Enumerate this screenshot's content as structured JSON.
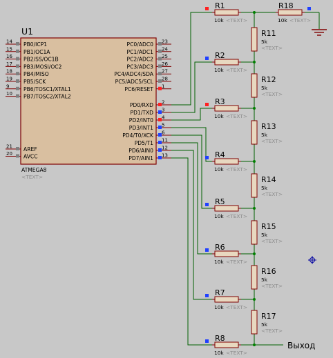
{
  "mcu": {
    "ref": "U1",
    "part": "ATMEGA8",
    "text_placeholder": "<TEXT>",
    "left_pins": [
      {
        "num": "14",
        "name": "PB0/ICP1"
      },
      {
        "num": "15",
        "name": "PB1/OC1A"
      },
      {
        "num": "16",
        "name": "PB2/SS/OC1B"
      },
      {
        "num": "17",
        "name": "PB3/MOSI/OC2"
      },
      {
        "num": "18",
        "name": "PB4/MISO"
      },
      {
        "num": "19",
        "name": "PB5/SCK"
      },
      {
        "num": "9",
        "name": "PB6/TOSC1/XTAL1"
      },
      {
        "num": "10",
        "name": "PB7/TOSC2/XTAL2"
      }
    ],
    "left_pins_bottom": [
      {
        "num": "21",
        "name": "AREF"
      },
      {
        "num": "20",
        "name": "AVCC"
      }
    ],
    "right_pins_top": [
      {
        "num": "23",
        "name": "PC0/ADC0"
      },
      {
        "num": "24",
        "name": "PC1/ADC1"
      },
      {
        "num": "25",
        "name": "PC2/ADC2"
      },
      {
        "num": "26",
        "name": "PC3/ADC3"
      },
      {
        "num": "27",
        "name": "PC4/ADC4/SDA"
      },
      {
        "num": "28",
        "name": "PC5/ADC5/SCL"
      },
      {
        "num": "1",
        "name": "PC6/RESET"
      }
    ],
    "right_pins_bottom": [
      {
        "num": "2",
        "name": "PD0/RXD"
      },
      {
        "num": "3",
        "name": "PD1/TXD"
      },
      {
        "num": "4",
        "name": "PD2/INT0"
      },
      {
        "num": "5",
        "name": "PD3/INT1"
      },
      {
        "num": "6",
        "name": "PD4/T0/XCK"
      },
      {
        "num": "11",
        "name": "PD5/T1"
      },
      {
        "num": "12",
        "name": "PD6/AIN0"
      },
      {
        "num": "13",
        "name": "PD7/AIN1"
      }
    ]
  },
  "resistors_h": [
    {
      "ref": "R1",
      "value": "10k",
      "text": "<TEXT>"
    },
    {
      "ref": "R2",
      "value": "10k",
      "text": "<TEXT>"
    },
    {
      "ref": "R3",
      "value": "10k",
      "text": "<TEXT>"
    },
    {
      "ref": "R4",
      "value": "10k",
      "text": "<TEXT>"
    },
    {
      "ref": "R5",
      "value": "10k",
      "text": "<TEXT>"
    },
    {
      "ref": "R6",
      "value": "10k",
      "text": "<TEXT>"
    },
    {
      "ref": "R7",
      "value": "10k",
      "text": "<TEXT>"
    },
    {
      "ref": "R8",
      "value": "10k",
      "text": "<TEXT>"
    },
    {
      "ref": "R18",
      "value": "10k",
      "text": "<TEXT>"
    }
  ],
  "resistors_v": [
    {
      "ref": "R11",
      "value": "5k",
      "text": "<TEXT>"
    },
    {
      "ref": "R12",
      "value": "5k",
      "text": "<TEXT>"
    },
    {
      "ref": "R13",
      "value": "5k",
      "text": "<TEXT>"
    },
    {
      "ref": "R14",
      "value": "5k",
      "text": "<TEXT>"
    },
    {
      "ref": "R15",
      "value": "5k",
      "text": "<TEXT>"
    },
    {
      "ref": "R16",
      "value": "5k",
      "text": "<TEXT>"
    },
    {
      "ref": "R17",
      "value": "5k",
      "text": "<TEXT>"
    }
  ],
  "output_label": "Выход",
  "colors": {
    "background": "#c8c8c8",
    "component_outline": "#800000",
    "component_fill": "#e8d8c0",
    "mcu_fill": "#d9bfa0",
    "wire": "#006000",
    "pin_high": "#ff2020",
    "pin_low": "#2040ff",
    "pin_idle": "#808080",
    "placeholder_text": "#8c8c8c",
    "junction": "#008000",
    "cursor": "#0000a0"
  }
}
